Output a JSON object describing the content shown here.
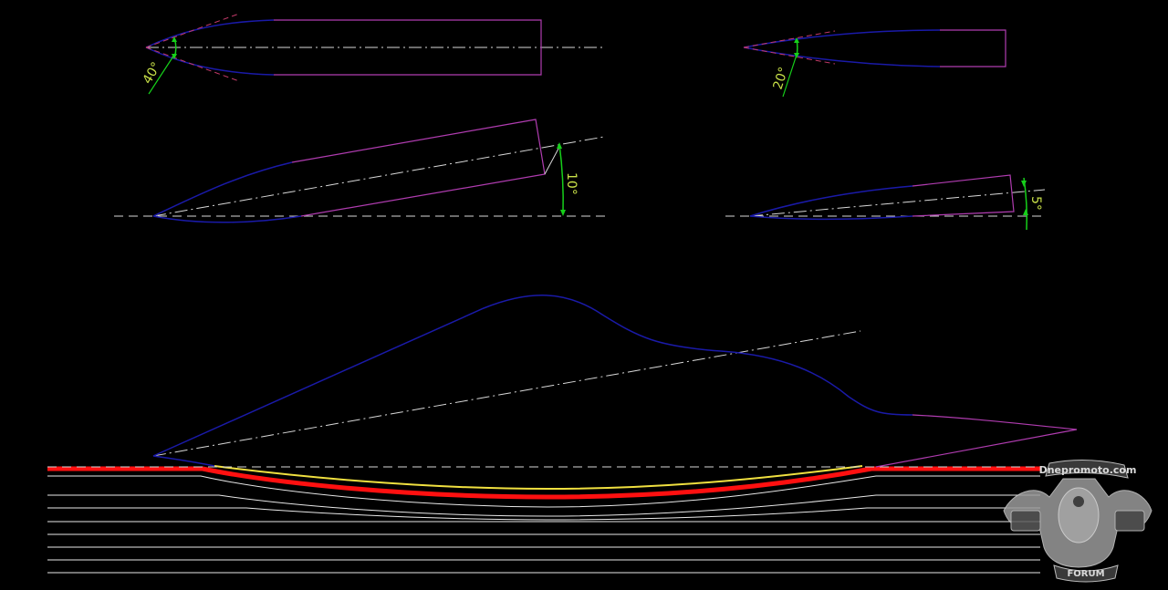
{
  "drawing": {
    "colors": {
      "background": "#000000",
      "blade_profile": "#1a1aa8",
      "blade_body": "#b03cb0",
      "centerline": "#d8d8d8",
      "reference": "#d8d8d8",
      "dimension": "#16d01a",
      "dimension_text": "#c8e048",
      "tangent_lines": "#c43a6a",
      "stone_red": "#ff1010",
      "stone_yellow": "#f0e040",
      "stone_lines": "#e8e8e8"
    },
    "angles": {
      "top_left": "40°",
      "top_right": "20°",
      "mid_left": "10°",
      "mid_right": "5°"
    }
  },
  "watermark": {
    "site": "Dnepromoto.com",
    "label": "FORUM",
    "icon": "motorcycle-engine-emblem-icon"
  }
}
